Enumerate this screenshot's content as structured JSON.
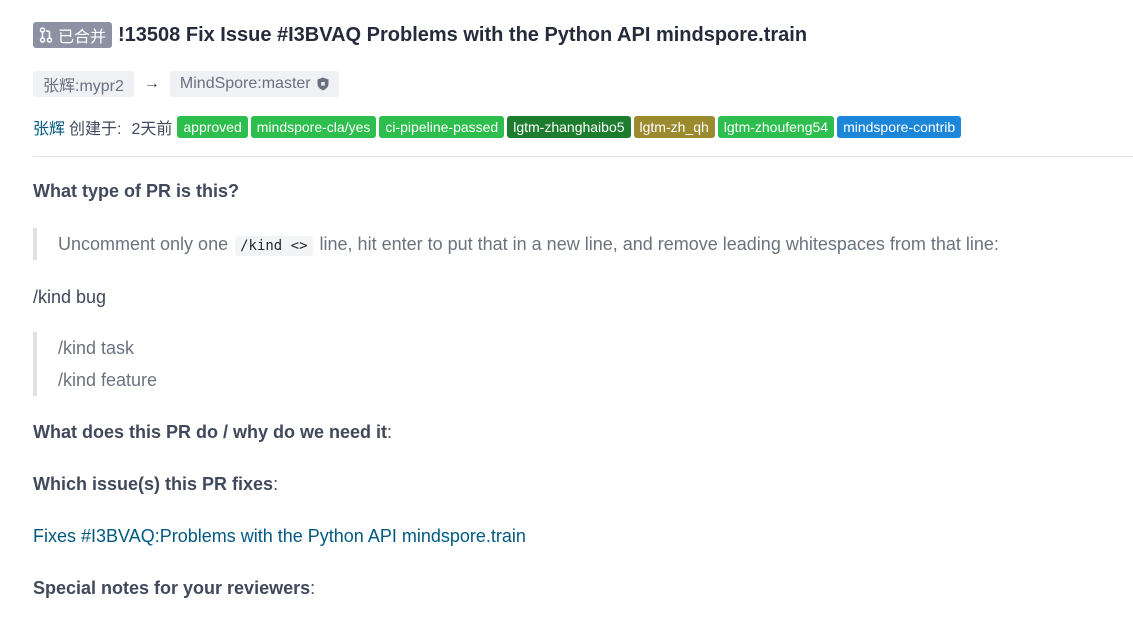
{
  "pr": {
    "status_badge": "已合并",
    "title": "!13508 Fix Issue #I3BVAQ Problems with the Python API mindspore.train",
    "source_branch": "张辉:mypr2",
    "arrow": "→",
    "target_branch": "MindSpore:master",
    "author": "张辉",
    "created_label": "创建于:",
    "created_time": "2天前"
  },
  "labels": [
    {
      "text": "approved",
      "color": "#2dbe4e"
    },
    {
      "text": "mindspore-cla/yes",
      "color": "#2dbe4e"
    },
    {
      "text": "ci-pipeline-passed",
      "color": "#2dbe4e"
    },
    {
      "text": "lgtm-zhanghaibo5",
      "color": "#1d7d2f"
    },
    {
      "text": "lgtm-zh_qh",
      "color": "#9b8a2e"
    },
    {
      "text": "lgtm-zhoufeng54",
      "color": "#2dbe4e"
    },
    {
      "text": "mindspore-contrib",
      "color": "#1c86d9"
    }
  ],
  "body": {
    "heading_type": "What type of PR is this?",
    "quote1_before": "Uncomment only one ",
    "quote1_code": "/kind <>",
    "quote1_after": " line, hit enter to put that in a new line, and remove leading whitespaces from that line:",
    "kind_bug": "/kind bug",
    "quote2_line1": "/kind task",
    "quote2_line2": "/kind feature",
    "heading_what": "What does this PR do / why do we need it",
    "heading_which": "Which issue(s) this PR fixes",
    "fixes_prefix": "Fixes ",
    "fixes_link": "#I3BVAQ:Problems with the Python API mindspore.train",
    "heading_notes": "Special notes for your reviewers",
    "colon": ":"
  }
}
